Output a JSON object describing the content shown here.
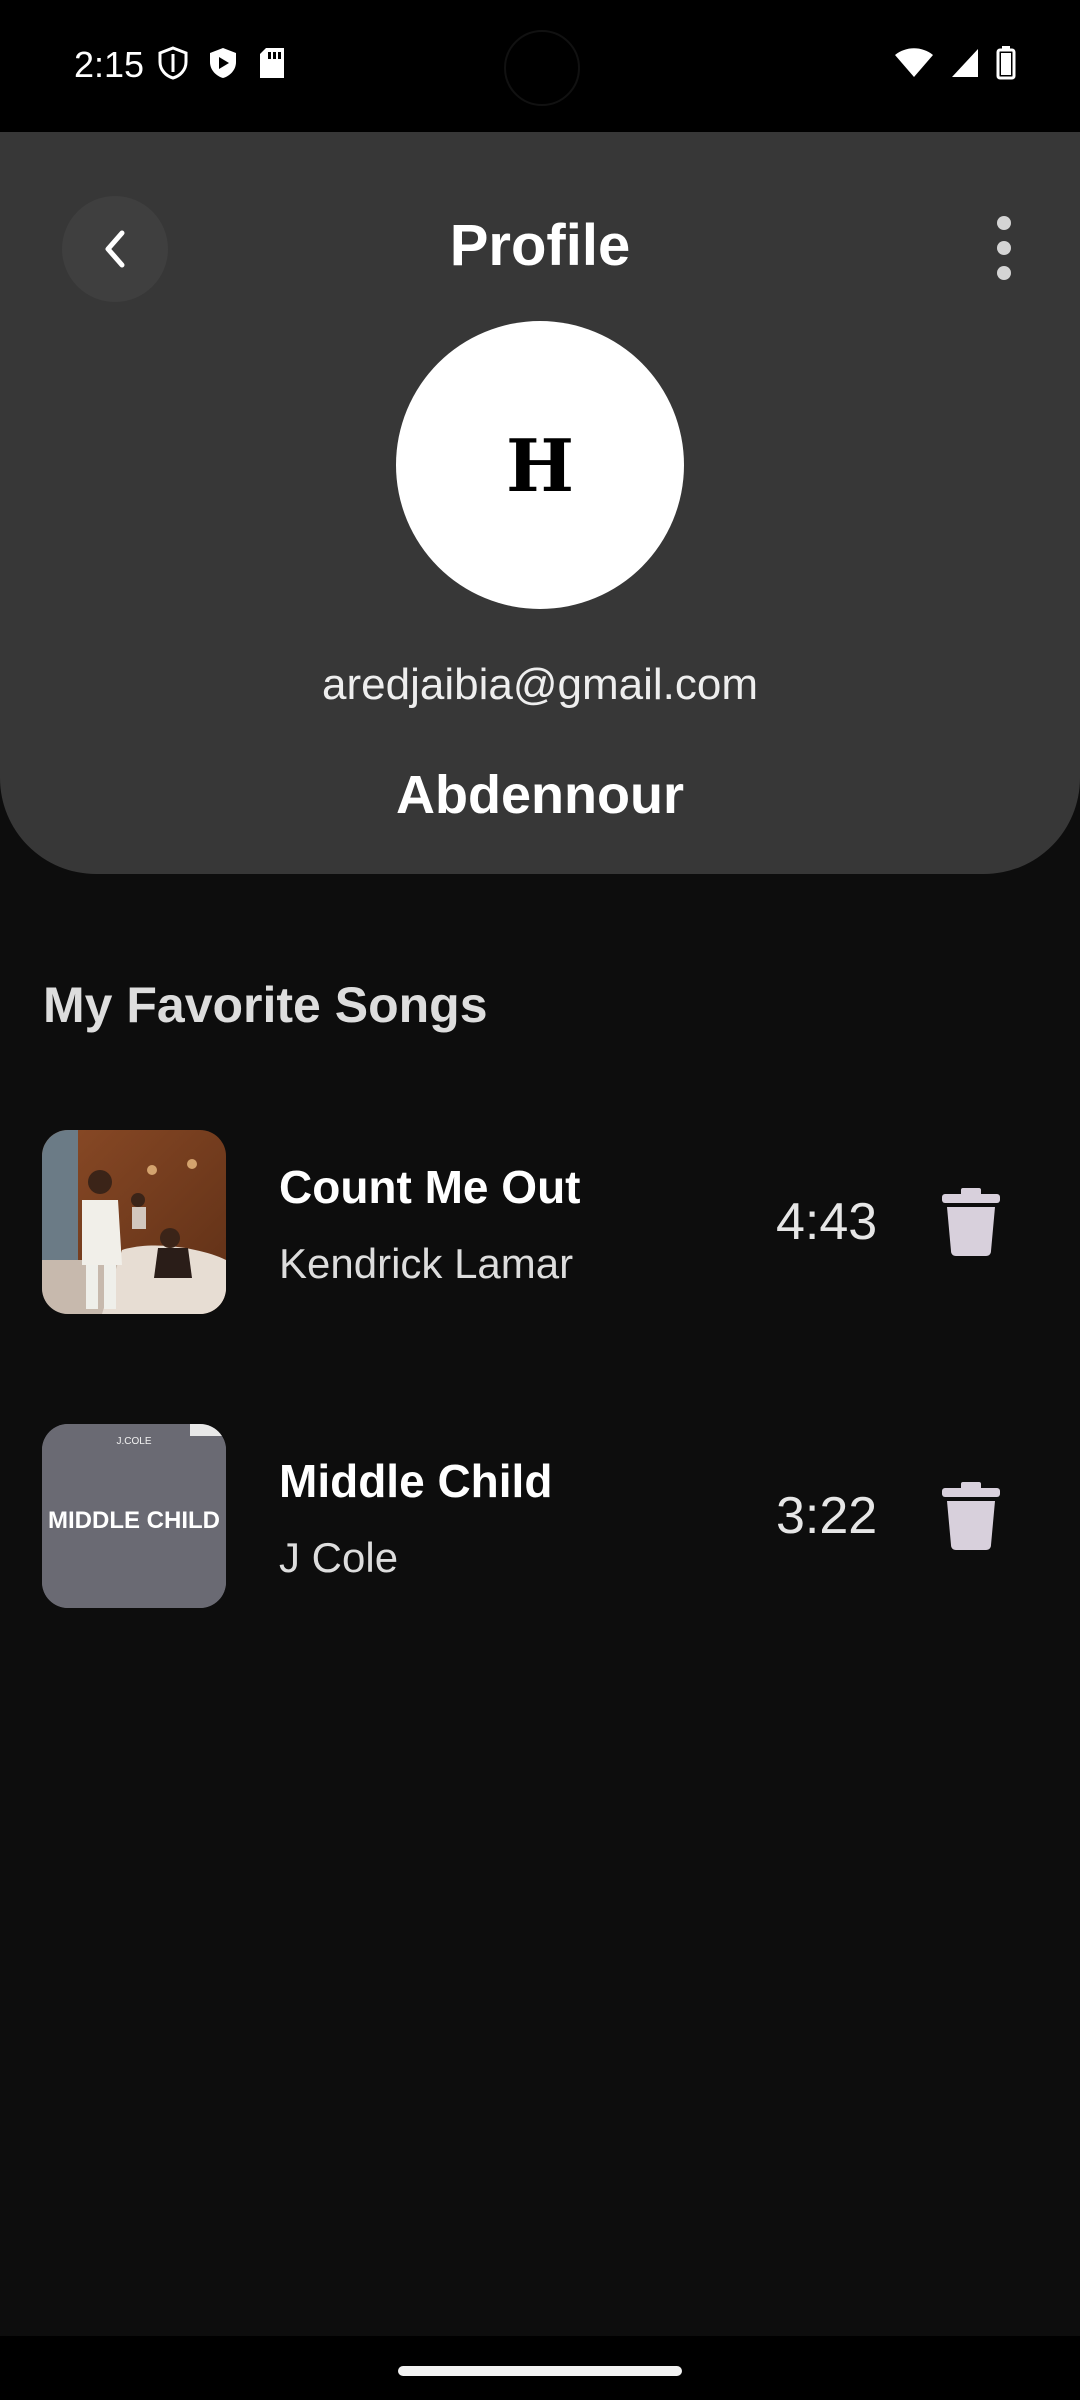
{
  "status_bar": {
    "time": "2:15"
  },
  "header": {
    "title": "Profile"
  },
  "profile": {
    "avatar_initial": "H",
    "email": "aredjaibia@gmail.com",
    "name": "Abdennour"
  },
  "favorites": {
    "title": "My Favorite Songs",
    "songs": [
      {
        "title": "Count Me Out",
        "artist": "Kendrick Lamar",
        "duration": "4:43"
      },
      {
        "title": "Middle Child",
        "artist": "J Cole",
        "duration": "3:22",
        "cover_text": "MIDDLE CHILD",
        "cover_top_text": "J.COLE"
      }
    ]
  },
  "colors": {
    "background": "#0d0d0d",
    "card": "#373737",
    "accent_icon": "#d8d0dc"
  }
}
